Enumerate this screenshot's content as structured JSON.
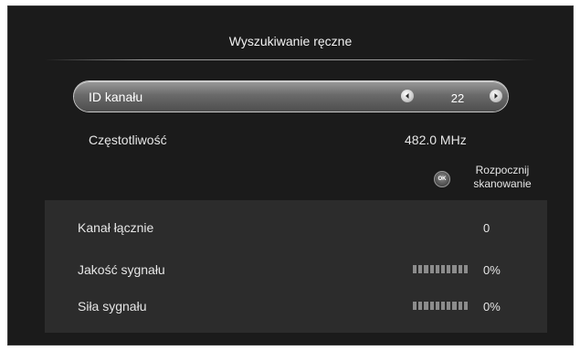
{
  "dialog": {
    "title": "Wyszukiwanie ręczne"
  },
  "channel": {
    "label": "ID kanału",
    "value": "22",
    "left_icon": "arrow-left-icon",
    "right_icon": "arrow-right-icon"
  },
  "frequency": {
    "label": "Częstotliwość",
    "value": "482.0  MHz"
  },
  "scan": {
    "icon": "ok-button-icon",
    "ok_text": "OK",
    "label_line1": "Rozpocznij",
    "label_line2": "skanowanie"
  },
  "stats": {
    "total_channels": {
      "label": "Kanał łącznie",
      "value": "0"
    },
    "signal_quality": {
      "label": "Jakość sygnału",
      "value": "0%",
      "level_fraction": 0
    },
    "signal_strength": {
      "label": "Siła sygnału",
      "value": "0%",
      "level_fraction": 0
    }
  },
  "colors": {
    "background": "#1b1b1b",
    "panel": "#2c2c2c",
    "text": "#e6e6e6",
    "highlight": "#7a7a7a"
  }
}
